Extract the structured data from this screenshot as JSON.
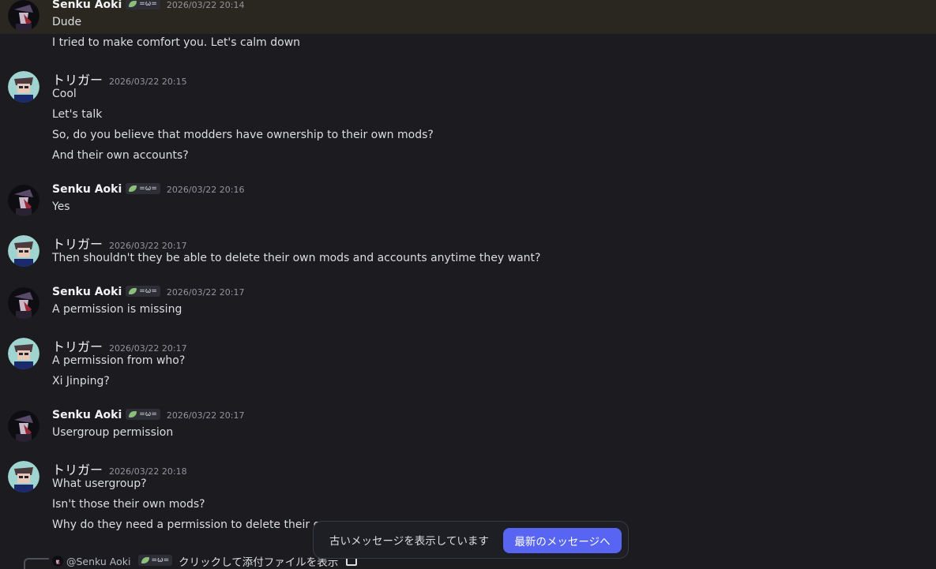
{
  "users": {
    "senku": {
      "name": "Senku Aoki",
      "tag": "=ω="
    },
    "trigger": {
      "name": "トリガー"
    }
  },
  "groups": [
    {
      "user": "senku",
      "time": "2026/03/22 20:14",
      "lines": [
        "Dude",
        "I tried to make comfort you. Let's calm down"
      ],
      "highlight": true
    },
    {
      "user": "trigger",
      "time": "2026/03/22 20:15",
      "lines": [
        "Cool",
        "Let's talk",
        "So, do you believe that modders have ownership to their own mods?",
        "And their own accounts?"
      ]
    },
    {
      "user": "senku",
      "time": "2026/03/22 20:16",
      "lines": [
        "Yes"
      ]
    },
    {
      "user": "trigger",
      "time": "2026/03/22 20:17",
      "lines": [
        "Then shouldn't they be able to delete their own mods and accounts anytime they want?"
      ]
    },
    {
      "user": "senku",
      "time": "2026/03/22 20:17",
      "lines": [
        "A permission is missing"
      ]
    },
    {
      "user": "trigger",
      "time": "2026/03/22 20:17",
      "lines": [
        "A permission from who?",
        "Xi Jinping?"
      ]
    },
    {
      "user": "senku",
      "time": "2026/03/22 20:17",
      "lines": [
        "Usergroup permission"
      ]
    },
    {
      "user": "trigger",
      "time": "2026/03/22 20:18",
      "lines": [
        "What usergroup?",
        "Isn't those their own mods?",
        "Why do they need a permission to delete their ow"
      ]
    }
  ],
  "toast": {
    "text": "古いメッセージを表示しています",
    "button": "最新のメッセージへ"
  },
  "reply": {
    "user": "@Senku Aoki",
    "tag": "=ω=",
    "text": "クリックして添付ファイルを表示"
  },
  "colors": {
    "background": "#1b1b20",
    "highlight": "#2a2720",
    "accent": "#5865f2",
    "tag_leaf": "#8cbf7a"
  }
}
